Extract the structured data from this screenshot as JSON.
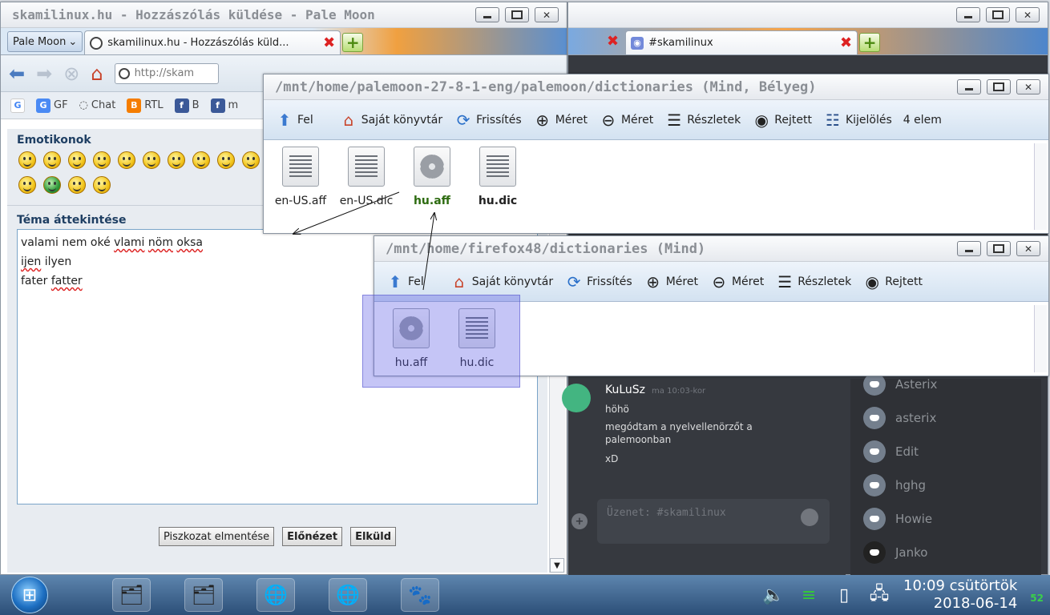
{
  "palemoon": {
    "title": "skamilinux.hu - Hozzászólás küldése - Pale Moon",
    "app_menu": "Pale Moon",
    "tab_label": "skamilinux.hu - Hozzászólás küld...",
    "url": "http://skam",
    "bookmarks": [
      {
        "label": "GF",
        "icon": "google-translate-icon"
      },
      {
        "label": "Chat",
        "icon": "chat-icon"
      },
      {
        "label": "RTL",
        "icon": "blogger-icon"
      },
      {
        "label": "B",
        "icon": "facebook-icon"
      },
      {
        "label": "m",
        "icon": "bookmark-icon"
      }
    ],
    "emoticons_title": "Emotikonok",
    "overview_title": "Téma áttekintése",
    "text_lines": [
      "valami nem oké vlami nöm oksa",
      "ijen ilyen",
      "fater fatter"
    ],
    "text_misspelled": [
      "vlami",
      "nöm",
      "oksa",
      "ijen",
      "fatter"
    ],
    "buttons": {
      "draft": "Piszkozat elmentése",
      "preview": "Előnézet",
      "send": "Elküld"
    }
  },
  "discord": {
    "tab_label": "#skamilinux",
    "message": {
      "author": "KuLuSz",
      "time": "ma 10:03-kor",
      "lines": [
        "höhö",
        "megódtam a nyelvellenörzőt a palemoonban",
        "xD"
      ]
    },
    "input_placeholder": "Üzenet: #skamilinux",
    "members": [
      "Asterix",
      "asterix",
      "Edit",
      "hghg",
      "Howie",
      "Janko"
    ]
  },
  "filemanager1": {
    "title": "/mnt/home/palemoon-27-8-1-eng/palemoon/dictionaries (Mind, Bélyeg)",
    "toolbar": [
      "Fel",
      "Saját könyvtár",
      "Frissítés",
      "Méret",
      "Méret",
      "Részletek",
      "Rejtett",
      "Kijelölés"
    ],
    "count": "4 elem",
    "files": [
      {
        "name": "en-US.aff",
        "type": "text"
      },
      {
        "name": "en-US.dic",
        "type": "text"
      },
      {
        "name": "hu.aff",
        "type": "gear"
      },
      {
        "name": "hu.dic",
        "type": "text"
      }
    ]
  },
  "filemanager2": {
    "title": "/mnt/home/firefox48/dictionaries (Mind)",
    "toolbar": [
      "Fel",
      "Saját könyvtár",
      "Frissítés",
      "Méret",
      "Méret",
      "Részletek",
      "Rejtett"
    ],
    "files": [
      {
        "name": "hu.aff",
        "type": "gear"
      },
      {
        "name": "hu.dic",
        "type": "text"
      }
    ]
  },
  "taskbar": {
    "clock_time": "10:09 csütörtök",
    "clock_date": "2018-06-14",
    "corner": "52"
  },
  "colors": {
    "taskbar": "#3b628c",
    "discord_bg": "#36393f",
    "selection": "#5a5ae6"
  }
}
